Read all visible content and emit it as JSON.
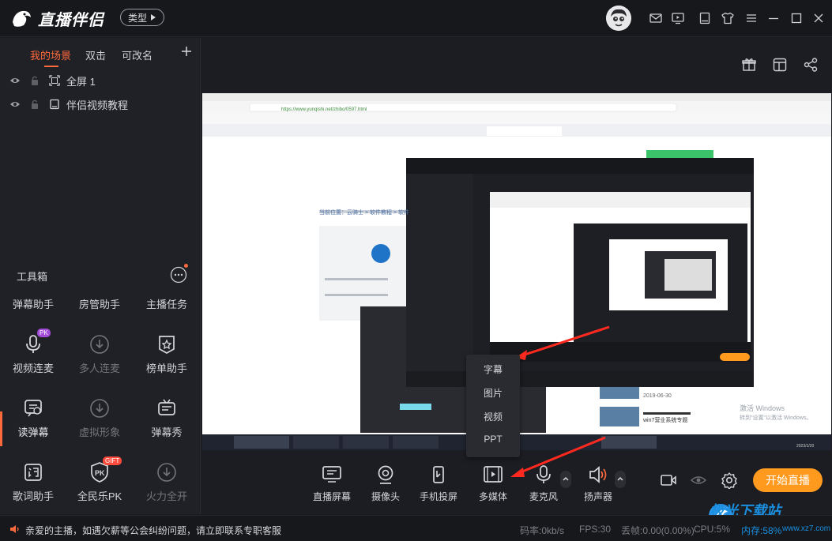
{
  "app": {
    "name": "直播伴侣",
    "type_label": "类型"
  },
  "scene_tabs": [
    "我的场景",
    "双击",
    "可改名"
  ],
  "sources": [
    {
      "label": "全屏 1",
      "icon": "fullscreen-icon"
    },
    {
      "label": "伴侣视频教程",
      "icon": "video-icon"
    }
  ],
  "toolbox": {
    "title": "工具箱",
    "top_row": [
      "弹幕助手",
      "房管助手",
      "主播任务"
    ],
    "tools": [
      {
        "label": "视频连麦",
        "icon": "mic-link-icon",
        "badge": "PK"
      },
      {
        "label": "多人连麦",
        "icon": "download-icon"
      },
      {
        "label": "榜单助手",
        "icon": "ranking-icon"
      },
      {
        "label": "读弹幕",
        "icon": "read-danmu-icon"
      },
      {
        "label": "虚拟形象",
        "icon": "download-icon"
      },
      {
        "label": "弹幕秀",
        "icon": "danmu-show-icon"
      },
      {
        "label": "歌词助手",
        "icon": "lyrics-icon"
      },
      {
        "label": "全民乐PK",
        "icon": "pk-icon",
        "badge": "GIFT"
      },
      {
        "label": "火力全开",
        "icon": "download-icon"
      }
    ]
  },
  "popup_menu": [
    "字幕",
    "图片",
    "视频",
    "PPT"
  ],
  "bottom_toolbar": [
    "直播屏幕",
    "摄像头",
    "手机投屏",
    "多媒体",
    "麦克风",
    "扬声器"
  ],
  "start_button": "开始直播",
  "status": {
    "notice": "亲爱的主播，如遇欠薪等公会纠纷问题，请立即联系专职客服",
    "bitrate": "码率:0kb/s",
    "fps": "FPS:30",
    "dropped": "丢帧:0.00(0.00%)",
    "cpu": "CPU:5%",
    "memory": "内存:58%"
  },
  "watermark": {
    "title": "极光下载站",
    "url": "www.xz7.com"
  },
  "preview": {
    "browser_url": "https://www.yunqishi.net/zhibo/0597.html",
    "page_text_1": "当前位置：云骑士 > 软件教程 > 软件",
    "win_watermark_1": "激活 Windows",
    "win_watermark_2": "转到\"设置\"以激活 Windows。",
    "date": "2019-06-30",
    "article_title": "win7营业系统专题",
    "time_label": "2023/1/20"
  },
  "colors": {
    "accent": "#ff6a3d",
    "start": "#ff9a1f",
    "arrow": "#ff2a1f"
  }
}
